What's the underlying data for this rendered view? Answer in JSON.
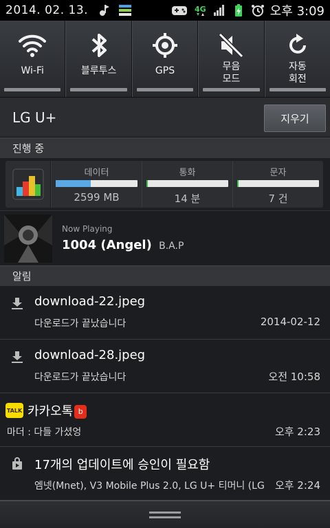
{
  "status_bar": {
    "date": "2014. 02. 13.",
    "time": "오후 3:09",
    "network": "4G",
    "icons": [
      "music-icon",
      "task-icon",
      "gamepad-icon",
      "4g-icon",
      "signal-icon",
      "battery-charging-icon",
      "alarm-icon"
    ]
  },
  "quick_settings": [
    {
      "label": "Wi-Fi",
      "icon": "wifi-icon"
    },
    {
      "label": "블루투스",
      "icon": "bluetooth-icon"
    },
    {
      "label": "GPS",
      "icon": "gps-icon"
    },
    {
      "label": "무음\n모드",
      "label_line1": "무음",
      "label_line2": "모드",
      "icon": "mute-icon"
    },
    {
      "label": "자동\n회전",
      "label_line1": "자동",
      "label_line2": "회전",
      "icon": "rotate-icon"
    }
  ],
  "carrier": {
    "name": "LG U+",
    "clear_label": "지우기"
  },
  "ongoing": {
    "header": "진행 중",
    "usage": {
      "data": {
        "label": "데이터",
        "value": "2599 MB",
        "fill_pct": 43,
        "color": "#5aa9e6"
      },
      "call": {
        "label": "통화",
        "value": "14 분",
        "fill_pct": 2,
        "color": "#35c24a"
      },
      "sms": {
        "label": "문자",
        "value": "7 건",
        "fill_pct": 2,
        "color": "#35c24a"
      }
    },
    "now_playing": {
      "label": "Now Playing",
      "title": "1004 (Angel)",
      "artist": "B.A.P"
    }
  },
  "alerts": {
    "header": "알림",
    "items": [
      {
        "title": "download-22.jpeg",
        "subtitle": "다운로드가 끝났습니다",
        "time": "2014-02-12",
        "icon": "download-icon"
      },
      {
        "title": "download-28.jpeg",
        "subtitle": "다운로드가 끝났습니다",
        "time": "오전 10:58",
        "icon": "download-icon"
      },
      {
        "title": "카카오톡",
        "badge": "b",
        "subtitle": "마더 : 다들 가셨엉",
        "time": "오후 2:23",
        "icon": "kakaotalk-icon",
        "icon_text": "TALK"
      },
      {
        "title": "17개의 업데이트에 승인이 필요함",
        "subtitle": "엠넷(Mnet), V3 Mobile Plus 2.0, LG U+ 티머니 (LG",
        "time": "오후 2:24",
        "icon": "shopping-bag-icon"
      }
    ]
  },
  "colors": {
    "accent_data": "#5aa9e6",
    "accent_green": "#35c24a",
    "kakao_yellow": "#f6dc00",
    "badge_red": "#e42e1b"
  }
}
